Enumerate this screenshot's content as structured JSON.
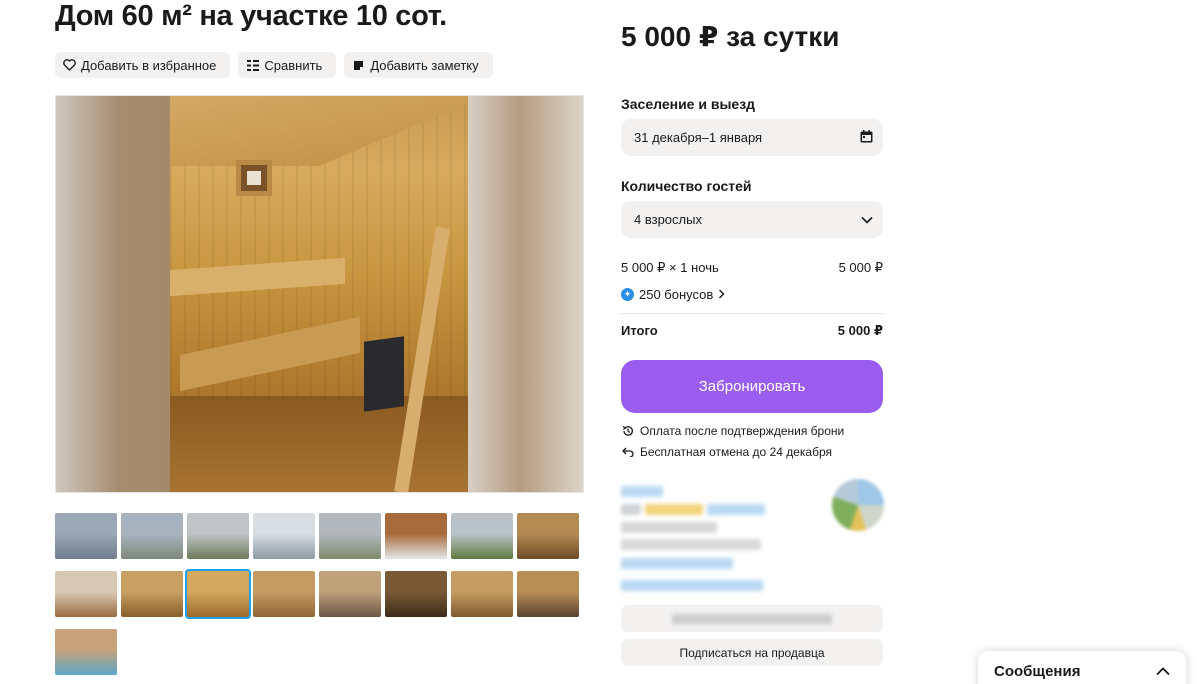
{
  "listing": {
    "title": "Дом 60 м² на участке 10 сот."
  },
  "actions": {
    "favorite_label": "Добавить в избранное",
    "compare_label": "Сравнить",
    "note_label": "Добавить заметку"
  },
  "gallery": {
    "selected_index": 10,
    "thumbnail_colors": [
      [
        "#9aa7b6",
        "#6f7d8f"
      ],
      [
        "#a8b3c0",
        "#7b8a79"
      ],
      [
        "#c0c4c6",
        "#6c7b5a"
      ],
      [
        "#d8dde2",
        "#8d9aa6"
      ],
      [
        "#b3b8bd",
        "#7e8a6b"
      ],
      [
        "#a86b3c",
        "#e3e6e8"
      ],
      [
        "#b9c2c9",
        "#5f7a3e"
      ],
      [
        "#b48a52",
        "#6e4a26"
      ],
      [
        "#d9c9b4",
        "#9a6b3e"
      ],
      [
        "#c8a062",
        "#8b5e2a"
      ],
      [
        "#d3a85f",
        "#9b6a2c"
      ],
      [
        "#c59a63",
        "#8f6634"
      ],
      [
        "#bfa17a",
        "#6a5644"
      ],
      [
        "#7a5a36",
        "#3a2a1a"
      ],
      [
        "#c59d62",
        "#7e5a2e"
      ],
      [
        "#b98e55",
        "#5a4230"
      ],
      [
        "#c7a27a",
        "#5fa7c9"
      ]
    ]
  },
  "booking": {
    "price": "5 000 ₽ за сутки",
    "checkin_label": "Заселение и выезд",
    "checkin_value": "31 декабря–1 января",
    "guests_label": "Количество гостей",
    "guests_value": "4 взрослых",
    "calc_label": "5 000 ₽ × 1 ночь",
    "calc_value": "5 000 ₽",
    "bonus_label": "250 бонусов",
    "total_label": "Итого",
    "total_value": "5 000 ₽",
    "book_button": "Забронировать",
    "note_payment": "Оплата после подтверждения брони",
    "note_cancel": "Бесплатная отмена до 24 декабря",
    "accent_color": "#9b5cf0"
  },
  "seller": {
    "subscribe_button": "Подписаться на продавца"
  },
  "messenger": {
    "label": "Сообщения"
  }
}
